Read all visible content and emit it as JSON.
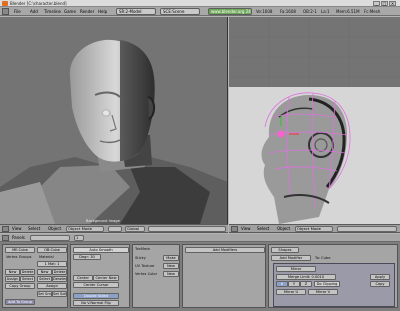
{
  "window": {
    "title": "Blender [C:\\character.blend]",
    "minimize": "_",
    "maximize": "□",
    "close": "✕"
  },
  "menubar": {
    "items": [
      "File",
      "Add",
      "Timeline",
      "Game",
      "Render",
      "Help"
    ],
    "screen_field": "SR:2-Model",
    "scene_field": "SCE:Scene",
    "url": "www.blender.org 243",
    "stats": [
      "Ve:1608",
      "Fa:1608",
      "OB:2-1",
      "La:1",
      "Mem:6.51M",
      "Fc:Mesh"
    ]
  },
  "left_viewport": {
    "header": {
      "view": "View",
      "select": "Select",
      "object": "Object",
      "mode": "Object Mode",
      "pivot": "Global",
      "layer_label": "Background image"
    }
  },
  "right_viewport": {
    "header": {
      "view": "View",
      "select": "Select",
      "object": "Object",
      "mode": "Object Mode"
    }
  },
  "buttons_window": {
    "toolbar": {
      "panels": "Panels",
      "current": "1",
      "ob_name": "OB:Cube"
    },
    "link_materials": {
      "me_field": "ME:Cube",
      "ob_field": "OB:Cube",
      "vertex_groups": "Vertex Groups",
      "material": "Material",
      "mat_index": "1 Mat: 1",
      "new": "New",
      "delete": "Delete",
      "assign": "Assign",
      "select": "Select",
      "deselect": "Deselect",
      "copy_group": "Copy Group",
      "set_smooth": "Set Smooth",
      "set_solid": "Set Solid",
      "add_to_group": "Add To Group"
    },
    "mesh": {
      "auto_smooth": "Auto Smooth",
      "degr": "Degr: 30",
      "center": "Center",
      "center_new": "Center New",
      "center_cursor": "Center Cursor",
      "double_sided": "Double Sided",
      "no_v_normal_flip": "No V.Normal Flip"
    },
    "textures": {
      "title": "TexMesh",
      "sticky": "Sticky",
      "uv_texture": "UV Texture",
      "vertex_color": "Vertex Color",
      "make": "Make",
      "new": "New"
    },
    "modifiers": {
      "title": "Add Modifier",
      "to": "To: Cube",
      "add_button": "Add Modifiers"
    },
    "shapes": {
      "tab": "Shapes",
      "title": "Mirror",
      "merge_limit": "Merge Limit: 0.0010",
      "axes": [
        "X",
        "Y",
        "Z"
      ],
      "do_clipping": "Do Clipping",
      "mirror_u": "Mirror U",
      "mirror_v": "Mirror V",
      "apply": "Apply",
      "copy": "Copy"
    }
  }
}
